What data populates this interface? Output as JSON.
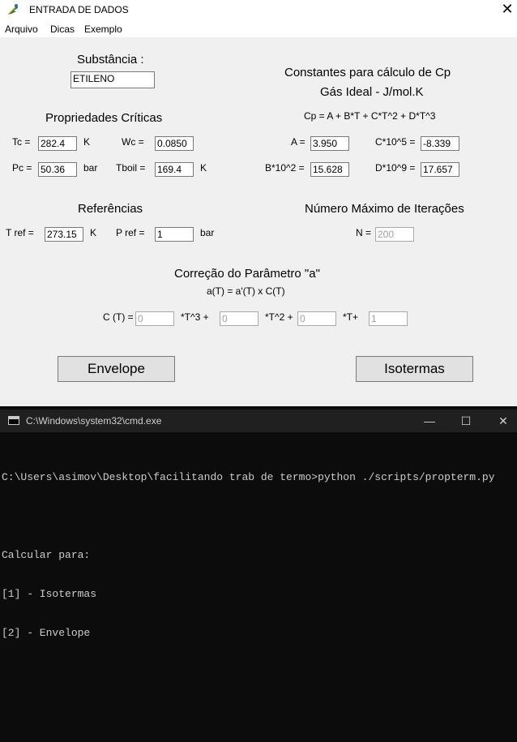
{
  "window": {
    "title": "ENTRADA DE DADOS"
  },
  "menu": {
    "items": [
      "Arquivo",
      "Dicas",
      "Exemplo"
    ]
  },
  "substance": {
    "label": "Substância :",
    "value": "ETILENO"
  },
  "critical": {
    "heading": "Propriedades Críticas",
    "tc_label": "Tc =",
    "tc_value": "282.4",
    "tc_unit": "K",
    "wc_label": "Wc =",
    "wc_value": "0.0850",
    "pc_label": "Pc =",
    "pc_value": "50.36",
    "pc_unit": "bar",
    "tboil_label": "Tboil =",
    "tboil_value": "169.4",
    "tboil_unit": "K"
  },
  "cp": {
    "heading1": "Constantes para cálculo de Cp",
    "heading2": "Gás Ideal - J/mol.K",
    "formula": "Cp = A + B*T + C*T^2 + D*T^3",
    "a_label": "A =",
    "a_value": "3.950",
    "c_label": "C*10^5 =",
    "c_value": "-8.339",
    "b_label": "B*10^2 =",
    "b_value": "15.628",
    "d_label": "D*10^9 =",
    "d_value": "17.657"
  },
  "refs": {
    "heading": "Referências",
    "tref_label": "T ref =",
    "tref_value": "273.15",
    "tref_unit": "K",
    "pref_label": "P ref =",
    "pref_value": "1",
    "pref_unit": "bar"
  },
  "iter": {
    "heading": "Número Máximo de Iterações",
    "n_label": "N =",
    "n_value": "200"
  },
  "correction": {
    "heading": "Correção do Parâmetro \"a\"",
    "formula": "a(T) = a'(T) x C(T)",
    "ct_label": "C (T) =",
    "v1": "0",
    "t3_label": "*T^3 +",
    "v2": "0",
    "t2_label": "*T^2 +",
    "v3": "0",
    "t1_label": "*T+",
    "v4": "1"
  },
  "buttons": {
    "envelope": "Envelope",
    "isotermas": "Isotermas"
  },
  "cmd": {
    "title": "C:\\Windows\\system32\\cmd.exe",
    "lines": [
      "C:\\Users\\asimov\\Desktop\\facilitando trab de termo>python ./scripts/propterm.py",
      "",
      "Calcular para:",
      "[1] - Isotermas",
      "[2] - Envelope"
    ]
  }
}
